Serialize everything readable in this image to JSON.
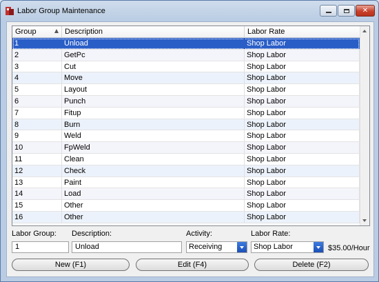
{
  "window": {
    "title": "Labor Group Maintenance"
  },
  "table": {
    "columns": [
      "Group",
      "Description",
      "Labor Rate"
    ],
    "rows": [
      {
        "group": "1",
        "description": "Unload",
        "rate": "Shop Labor"
      },
      {
        "group": "2",
        "description": "GetPc",
        "rate": "Shop Labor"
      },
      {
        "group": "3",
        "description": "Cut",
        "rate": "Shop Labor"
      },
      {
        "group": "4",
        "description": "Move",
        "rate": "Shop Labor"
      },
      {
        "group": "5",
        "description": "Layout",
        "rate": "Shop Labor"
      },
      {
        "group": "6",
        "description": "Punch",
        "rate": "Shop Labor"
      },
      {
        "group": "7",
        "description": "Fitup",
        "rate": "Shop Labor"
      },
      {
        "group": "8",
        "description": "Burn",
        "rate": "Shop Labor"
      },
      {
        "group": "9",
        "description": "Weld",
        "rate": "Shop Labor"
      },
      {
        "group": "10",
        "description": "FpWeld",
        "rate": "Shop Labor"
      },
      {
        "group": "11",
        "description": "Clean",
        "rate": "Shop Labor"
      },
      {
        "group": "12",
        "description": "Check",
        "rate": "Shop Labor"
      },
      {
        "group": "13",
        "description": "Paint",
        "rate": "Shop Labor"
      },
      {
        "group": "14",
        "description": "Load",
        "rate": "Shop Labor"
      },
      {
        "group": "15",
        "description": "Other",
        "rate": "Shop Labor"
      },
      {
        "group": "16",
        "description": "Other",
        "rate": "Shop Labor"
      }
    ],
    "selected_row": 1
  },
  "form": {
    "labor_group_label": "Labor Group:",
    "labor_group_value": "1",
    "description_label": "Description:",
    "description_value": "Unload",
    "activity_label": "Activity:",
    "activity_value": "Receiving",
    "labor_rate_label": "Labor Rate:",
    "labor_rate_value": "Shop Labor",
    "rate_display": "$35.00/Hour"
  },
  "buttons": {
    "new_label": "New (F1)",
    "edit_label": "Edit (F4)",
    "delete_label": "Delete (F2)"
  },
  "icons": {
    "app": "app-icon",
    "minimize": "minimize-icon",
    "maximize": "maximize-icon",
    "close": "close-icon",
    "sort": "sort-ascending-icon"
  },
  "colors": {
    "selection": "#2a5ec7",
    "close_button": "#c7412b"
  }
}
